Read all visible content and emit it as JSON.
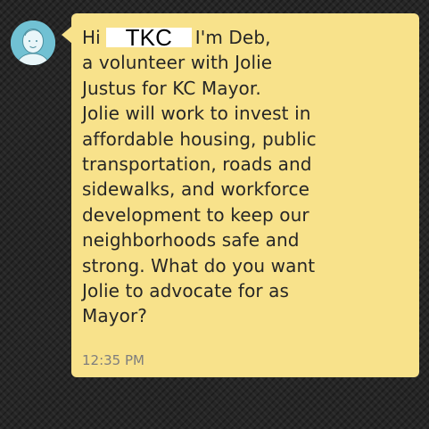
{
  "conversation": {
    "sender_avatar_icon": "person-avatar-icon",
    "message": {
      "greeting": "Hi",
      "redacted_name": "TKC",
      "body_line1": "I'm Deb,",
      "lines": [
        "a volunteer with Jolie",
        "Justus for KC Mayor.",
        "Jolie will work to invest in",
        "affordable housing, public",
        "transportation, roads and",
        "sidewalks, and workforce",
        "development to keep our",
        "neighborhoods safe and",
        "strong. What do you want",
        "Jolie to advocate for as",
        "Mayor?"
      ],
      "timestamp": "12:35 PM"
    },
    "colors": {
      "bubble": "#f8e28b",
      "avatar_bg": "#71c1d3",
      "background": "#262626",
      "timestamp": "#7e7e7e"
    }
  }
}
